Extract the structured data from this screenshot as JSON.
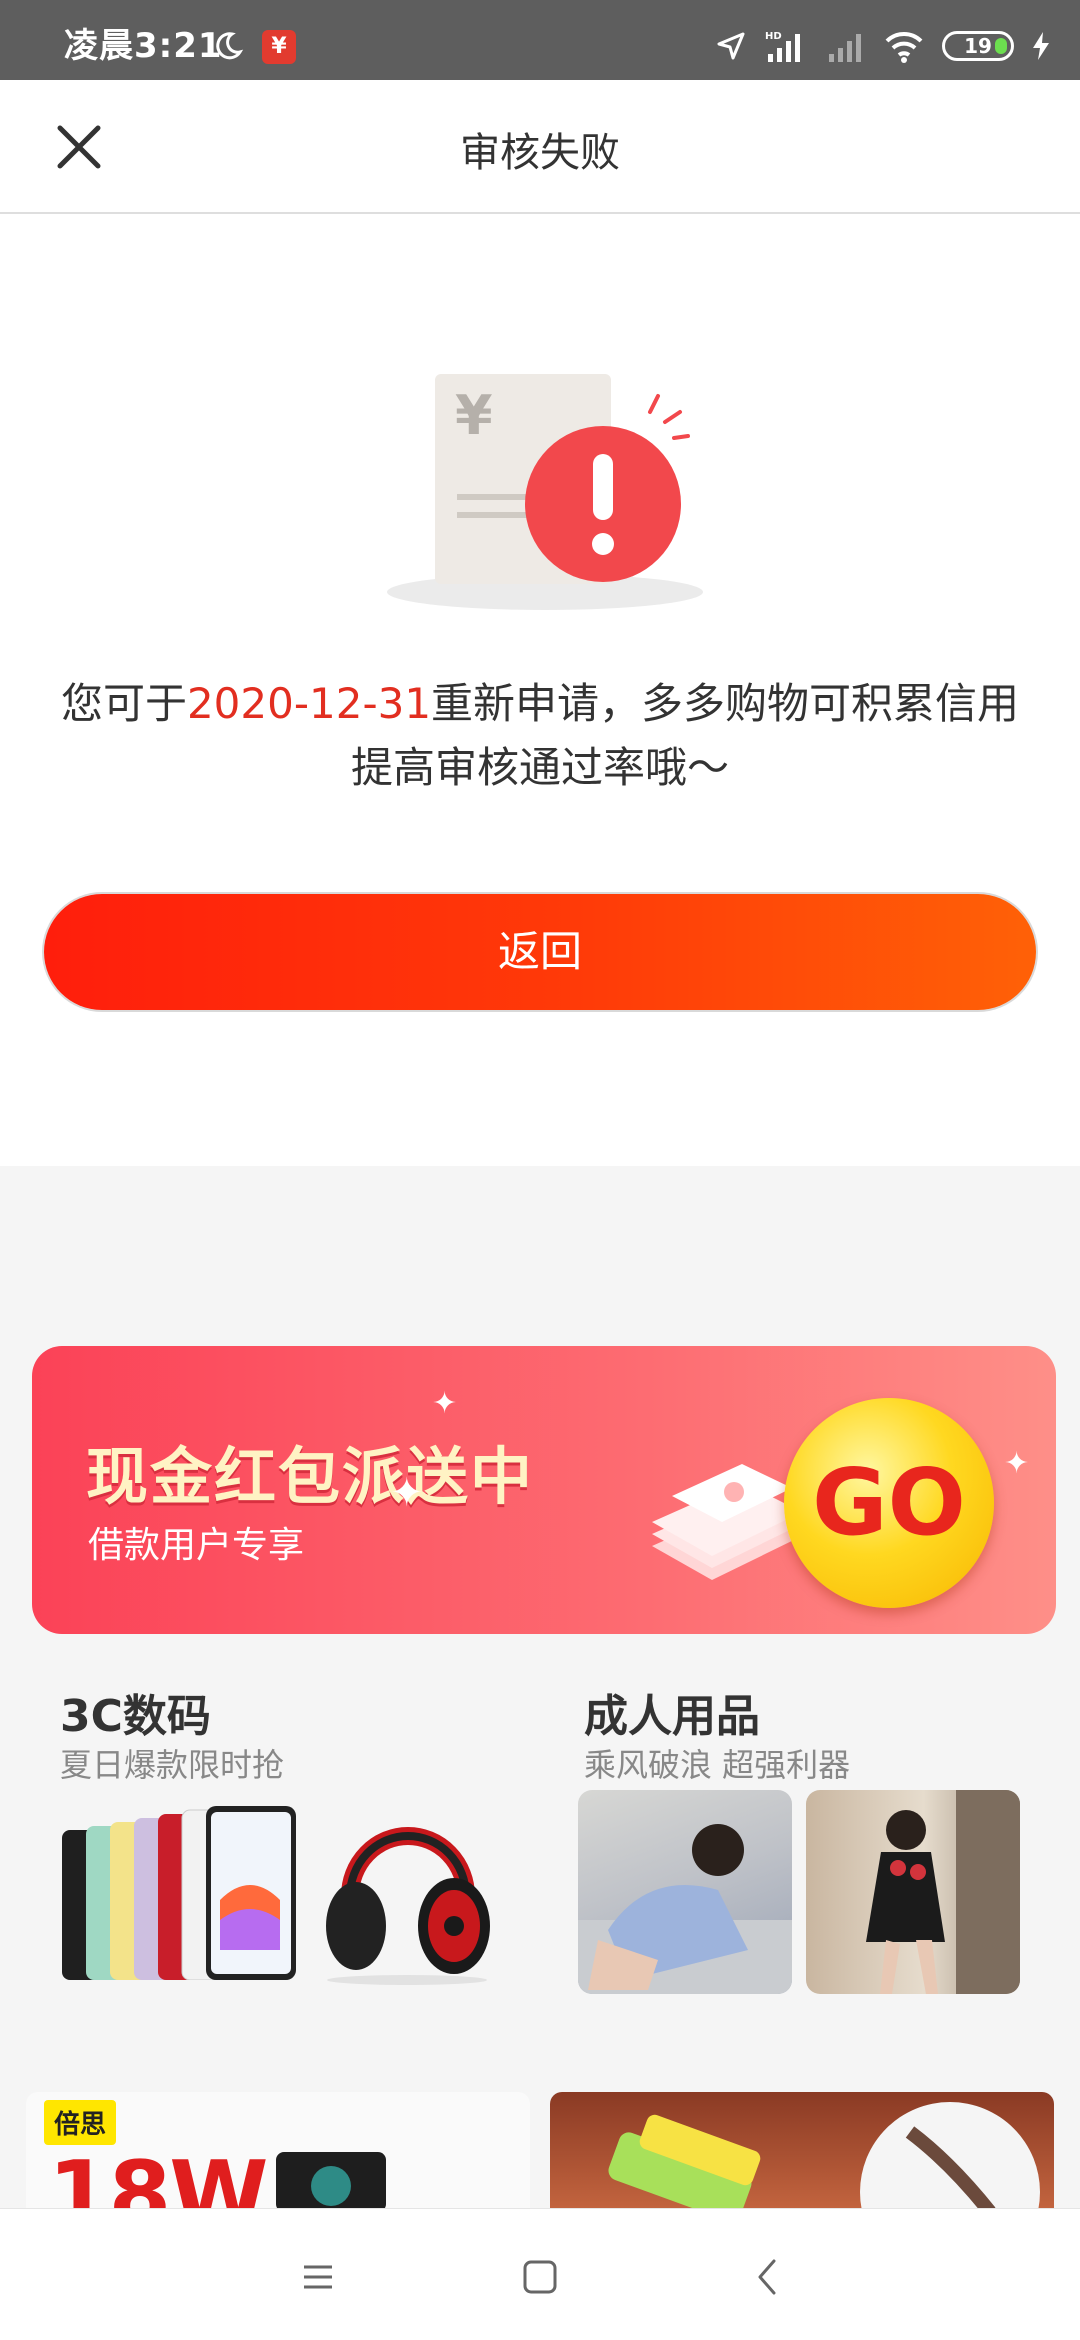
{
  "status_bar": {
    "time": "凌晨3:21",
    "battery": "19",
    "app_badge": "¥"
  },
  "header": {
    "title": "审核失败"
  },
  "main": {
    "message_prefix": "您可于",
    "message_date": "2020-12-31",
    "message_suffix": "重新申请，多多购物可积累信用提高审核通过率哦～",
    "back_button": "返回",
    "colors": {
      "accent": "#e22e20",
      "button_start": "#ff1e0c",
      "button_end": "#ff6107"
    }
  },
  "banner": {
    "title": "现金红包派送中",
    "subtitle": "借款用户专享",
    "go_label": "GO"
  },
  "categories": [
    {
      "title": "3C数码",
      "subtitle": "夏日爆款限时抢"
    },
    {
      "title": "成人用品",
      "subtitle": "乘风破浪 超强利器"
    }
  ],
  "cards": {
    "left_badge": "倍思",
    "left_headline": "18W"
  }
}
